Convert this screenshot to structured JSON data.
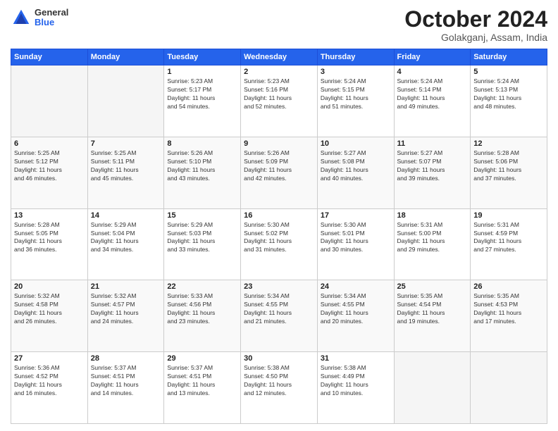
{
  "logo": {
    "general": "General",
    "blue": "Blue"
  },
  "header": {
    "month": "October 2024",
    "location": "Golakganj, Assam, India"
  },
  "weekdays": [
    "Sunday",
    "Monday",
    "Tuesday",
    "Wednesday",
    "Thursday",
    "Friday",
    "Saturday"
  ],
  "weeks": [
    [
      {
        "day": "",
        "info": ""
      },
      {
        "day": "",
        "info": ""
      },
      {
        "day": "1",
        "info": "Sunrise: 5:23 AM\nSunset: 5:17 PM\nDaylight: 11 hours\nand 54 minutes."
      },
      {
        "day": "2",
        "info": "Sunrise: 5:23 AM\nSunset: 5:16 PM\nDaylight: 11 hours\nand 52 minutes."
      },
      {
        "day": "3",
        "info": "Sunrise: 5:24 AM\nSunset: 5:15 PM\nDaylight: 11 hours\nand 51 minutes."
      },
      {
        "day": "4",
        "info": "Sunrise: 5:24 AM\nSunset: 5:14 PM\nDaylight: 11 hours\nand 49 minutes."
      },
      {
        "day": "5",
        "info": "Sunrise: 5:24 AM\nSunset: 5:13 PM\nDaylight: 11 hours\nand 48 minutes."
      }
    ],
    [
      {
        "day": "6",
        "info": "Sunrise: 5:25 AM\nSunset: 5:12 PM\nDaylight: 11 hours\nand 46 minutes."
      },
      {
        "day": "7",
        "info": "Sunrise: 5:25 AM\nSunset: 5:11 PM\nDaylight: 11 hours\nand 45 minutes."
      },
      {
        "day": "8",
        "info": "Sunrise: 5:26 AM\nSunset: 5:10 PM\nDaylight: 11 hours\nand 43 minutes."
      },
      {
        "day": "9",
        "info": "Sunrise: 5:26 AM\nSunset: 5:09 PM\nDaylight: 11 hours\nand 42 minutes."
      },
      {
        "day": "10",
        "info": "Sunrise: 5:27 AM\nSunset: 5:08 PM\nDaylight: 11 hours\nand 40 minutes."
      },
      {
        "day": "11",
        "info": "Sunrise: 5:27 AM\nSunset: 5:07 PM\nDaylight: 11 hours\nand 39 minutes."
      },
      {
        "day": "12",
        "info": "Sunrise: 5:28 AM\nSunset: 5:06 PM\nDaylight: 11 hours\nand 37 minutes."
      }
    ],
    [
      {
        "day": "13",
        "info": "Sunrise: 5:28 AM\nSunset: 5:05 PM\nDaylight: 11 hours\nand 36 minutes."
      },
      {
        "day": "14",
        "info": "Sunrise: 5:29 AM\nSunset: 5:04 PM\nDaylight: 11 hours\nand 34 minutes."
      },
      {
        "day": "15",
        "info": "Sunrise: 5:29 AM\nSunset: 5:03 PM\nDaylight: 11 hours\nand 33 minutes."
      },
      {
        "day": "16",
        "info": "Sunrise: 5:30 AM\nSunset: 5:02 PM\nDaylight: 11 hours\nand 31 minutes."
      },
      {
        "day": "17",
        "info": "Sunrise: 5:30 AM\nSunset: 5:01 PM\nDaylight: 11 hours\nand 30 minutes."
      },
      {
        "day": "18",
        "info": "Sunrise: 5:31 AM\nSunset: 5:00 PM\nDaylight: 11 hours\nand 29 minutes."
      },
      {
        "day": "19",
        "info": "Sunrise: 5:31 AM\nSunset: 4:59 PM\nDaylight: 11 hours\nand 27 minutes."
      }
    ],
    [
      {
        "day": "20",
        "info": "Sunrise: 5:32 AM\nSunset: 4:58 PM\nDaylight: 11 hours\nand 26 minutes."
      },
      {
        "day": "21",
        "info": "Sunrise: 5:32 AM\nSunset: 4:57 PM\nDaylight: 11 hours\nand 24 minutes."
      },
      {
        "day": "22",
        "info": "Sunrise: 5:33 AM\nSunset: 4:56 PM\nDaylight: 11 hours\nand 23 minutes."
      },
      {
        "day": "23",
        "info": "Sunrise: 5:34 AM\nSunset: 4:55 PM\nDaylight: 11 hours\nand 21 minutes."
      },
      {
        "day": "24",
        "info": "Sunrise: 5:34 AM\nSunset: 4:55 PM\nDaylight: 11 hours\nand 20 minutes."
      },
      {
        "day": "25",
        "info": "Sunrise: 5:35 AM\nSunset: 4:54 PM\nDaylight: 11 hours\nand 19 minutes."
      },
      {
        "day": "26",
        "info": "Sunrise: 5:35 AM\nSunset: 4:53 PM\nDaylight: 11 hours\nand 17 minutes."
      }
    ],
    [
      {
        "day": "27",
        "info": "Sunrise: 5:36 AM\nSunset: 4:52 PM\nDaylight: 11 hours\nand 16 minutes."
      },
      {
        "day": "28",
        "info": "Sunrise: 5:37 AM\nSunset: 4:51 PM\nDaylight: 11 hours\nand 14 minutes."
      },
      {
        "day": "29",
        "info": "Sunrise: 5:37 AM\nSunset: 4:51 PM\nDaylight: 11 hours\nand 13 minutes."
      },
      {
        "day": "30",
        "info": "Sunrise: 5:38 AM\nSunset: 4:50 PM\nDaylight: 11 hours\nand 12 minutes."
      },
      {
        "day": "31",
        "info": "Sunrise: 5:38 AM\nSunset: 4:49 PM\nDaylight: 11 hours\nand 10 minutes."
      },
      {
        "day": "",
        "info": ""
      },
      {
        "day": "",
        "info": ""
      }
    ]
  ]
}
